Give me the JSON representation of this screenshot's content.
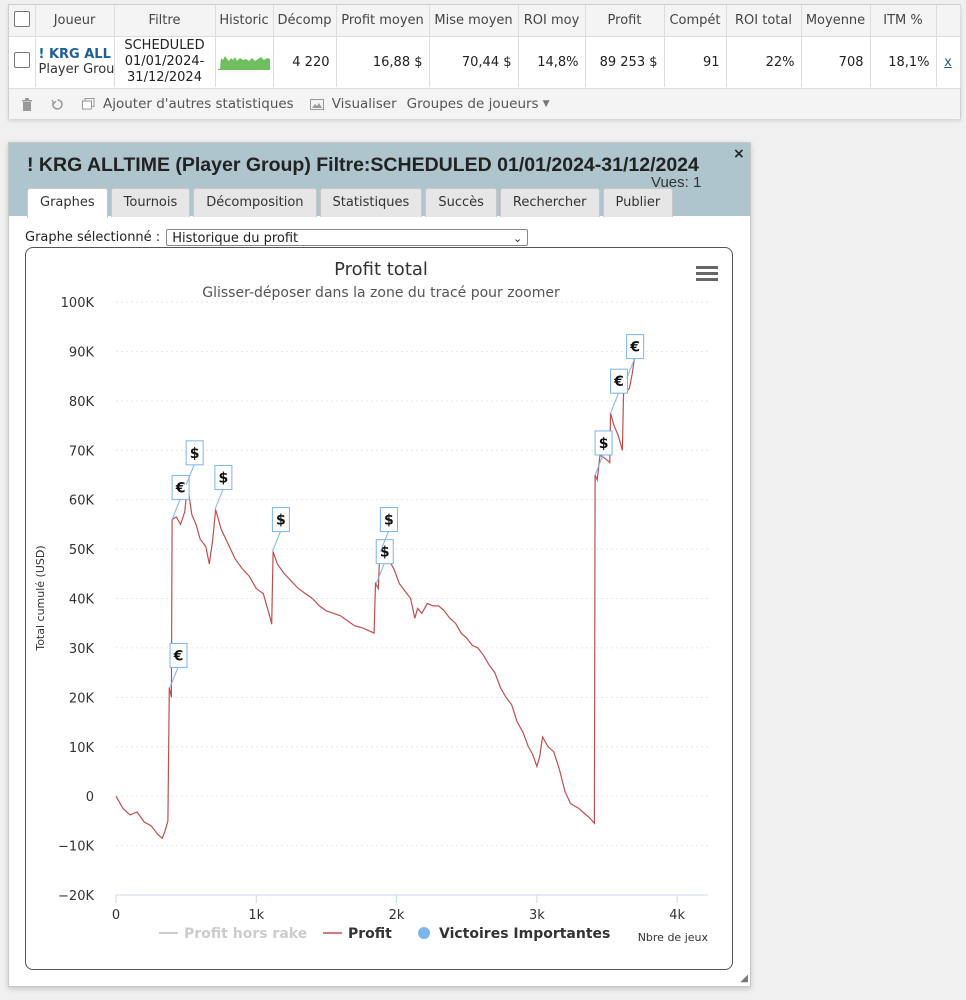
{
  "table": {
    "headers": [
      "Joueur",
      "Filtre",
      "Historic",
      "Décomp",
      "Profit moyen",
      "Mise moyen",
      "ROI moy",
      "Profit",
      "Compét",
      "ROI total",
      "Moyenne",
      "ITM %"
    ],
    "row": {
      "player_name": "! KRG ALL",
      "player_sub": "Player Grou",
      "filter": "SCHEDULED 01/01/2024-31/12/2024",
      "decomp": "4 220",
      "profit_moyen": "16,88 $",
      "mise_moyen": "70,44 $",
      "roi_moy": "14,8%",
      "profit": "89 253 $",
      "compet": "91",
      "roi_total": "22%",
      "moyenne": "708",
      "itm": "18,1%",
      "remove": "x"
    }
  },
  "toolbar": {
    "add_stats": "Ajouter d'autres statistiques",
    "visualize": "Visualiser",
    "groups": "Groupes de joueurs"
  },
  "dialog": {
    "title": "! KRG ALLTIME (Player Group) Filtre:SCHEDULED 01/01/2024-31/12/2024",
    "views": "Vues: 1",
    "close": "×",
    "tabs": [
      "Graphes",
      "Tournois",
      "Décomposition",
      "Statistiques",
      "Succès",
      "Rechercher",
      "Publier"
    ],
    "active_tab": 0,
    "select_label": "Graphe sélectionné :",
    "select_value": "Historique du profit"
  },
  "chart_data": {
    "type": "line",
    "title": "Profit total",
    "subtitle": "Glisser-déposer dans la zone du tracé pour zoomer",
    "xlabel": "Nbre de jeux",
    "ylabel": "Total cumulé (USD)",
    "xlim": [
      0,
      4220
    ],
    "ylim": [
      -20000,
      100000
    ],
    "x_ticks": [
      0,
      1000,
      2000,
      3000,
      4000
    ],
    "x_tick_labels": [
      "0",
      "1k",
      "2k",
      "3k",
      "4k"
    ],
    "y_ticks": [
      -20000,
      -10000,
      0,
      10000,
      20000,
      30000,
      40000,
      50000,
      60000,
      70000,
      80000,
      90000,
      100000
    ],
    "y_tick_labels": [
      "−20K",
      "−10K",
      "0",
      "10K",
      "20K",
      "30K",
      "40K",
      "50K",
      "60K",
      "70K",
      "80K",
      "90K",
      "100K"
    ],
    "grid": true,
    "legend": [
      "Profit hors rake",
      "Profit",
      "Victoires Importantes"
    ],
    "series": [
      {
        "name": "Profit",
        "color": "#c0504d",
        "points": [
          [
            0,
            0
          ],
          [
            50,
            -2500
          ],
          [
            100,
            -3800
          ],
          [
            150,
            -3200
          ],
          [
            200,
            -5200
          ],
          [
            250,
            -6000
          ],
          [
            300,
            -7800
          ],
          [
            330,
            -8500
          ],
          [
            350,
            -7000
          ],
          [
            370,
            -5000
          ],
          [
            380,
            22000
          ],
          [
            395,
            20000
          ],
          [
            400,
            56000
          ],
          [
            430,
            56500
          ],
          [
            460,
            55000
          ],
          [
            490,
            57500
          ],
          [
            510,
            63000
          ],
          [
            540,
            57000
          ],
          [
            570,
            55000
          ],
          [
            600,
            52000
          ],
          [
            640,
            50500
          ],
          [
            665,
            47000
          ],
          [
            690,
            52000
          ],
          [
            710,
            58000
          ],
          [
            750,
            54000
          ],
          [
            800,
            51000
          ],
          [
            850,
            48000
          ],
          [
            900,
            46000
          ],
          [
            950,
            44500
          ],
          [
            1000,
            42000
          ],
          [
            1050,
            41000
          ],
          [
            1080,
            38000
          ],
          [
            1100,
            36000
          ],
          [
            1110,
            34800
          ],
          [
            1120,
            49500
          ],
          [
            1150,
            47000
          ],
          [
            1200,
            45000
          ],
          [
            1250,
            43500
          ],
          [
            1300,
            42000
          ],
          [
            1350,
            41000
          ],
          [
            1400,
            40000
          ],
          [
            1450,
            38500
          ],
          [
            1500,
            37500
          ],
          [
            1550,
            37000
          ],
          [
            1600,
            36500
          ],
          [
            1650,
            35500
          ],
          [
            1700,
            34500
          ],
          [
            1760,
            34000
          ],
          [
            1800,
            33500
          ],
          [
            1840,
            33000
          ],
          [
            1850,
            43000
          ],
          [
            1870,
            42000
          ],
          [
            1880,
            49000
          ],
          [
            1900,
            49500
          ],
          [
            1940,
            48000
          ],
          [
            1980,
            46000
          ],
          [
            2020,
            43000
          ],
          [
            2060,
            41500
          ],
          [
            2100,
            40000
          ],
          [
            2130,
            36000
          ],
          [
            2150,
            38000
          ],
          [
            2180,
            37000
          ],
          [
            2220,
            39000
          ],
          [
            2260,
            38500
          ],
          [
            2300,
            38500
          ],
          [
            2340,
            37500
          ],
          [
            2380,
            36000
          ],
          [
            2420,
            35000
          ],
          [
            2460,
            33000
          ],
          [
            2500,
            32000
          ],
          [
            2540,
            30500
          ],
          [
            2580,
            30000
          ],
          [
            2620,
            28500
          ],
          [
            2660,
            26500
          ],
          [
            2700,
            25000
          ],
          [
            2740,
            22000
          ],
          [
            2780,
            20000
          ],
          [
            2820,
            18500
          ],
          [
            2860,
            15000
          ],
          [
            2900,
            13000
          ],
          [
            2940,
            10000
          ],
          [
            2970,
            8500
          ],
          [
            3000,
            6000
          ],
          [
            3020,
            8000
          ],
          [
            3040,
            12000
          ],
          [
            3080,
            10000
          ],
          [
            3120,
            9000
          ],
          [
            3160,
            5500
          ],
          [
            3200,
            1000
          ],
          [
            3240,
            -1500
          ],
          [
            3300,
            -2500
          ],
          [
            3340,
            -3500
          ],
          [
            3380,
            -4500
          ],
          [
            3410,
            -5500
          ],
          [
            3415,
            65000
          ],
          [
            3430,
            64000
          ],
          [
            3450,
            69000
          ],
          [
            3480,
            68500
          ],
          [
            3500,
            68000
          ],
          [
            3520,
            67500
          ],
          [
            3525,
            77500
          ],
          [
            3550,
            75000
          ],
          [
            3580,
            73000
          ],
          [
            3610,
            70000
          ],
          [
            3620,
            84000
          ],
          [
            3640,
            82000
          ],
          [
            3660,
            82500
          ],
          [
            3680,
            85500
          ],
          [
            3700,
            89500
          ],
          [
            3720,
            90500
          ],
          [
            3740,
            91000
          ],
          [
            3750,
            89500
          ]
        ]
      }
    ],
    "markers": [
      {
        "x": 385,
        "y": 22000,
        "label": "€"
      },
      {
        "x": 400,
        "y": 56000,
        "label": "€"
      },
      {
        "x": 500,
        "y": 63000,
        "label": "$"
      },
      {
        "x": 705,
        "y": 58000,
        "label": "$"
      },
      {
        "x": 1115,
        "y": 49500,
        "label": "$"
      },
      {
        "x": 1855,
        "y": 43000,
        "label": "$"
      },
      {
        "x": 1885,
        "y": 49500,
        "label": "$"
      },
      {
        "x": 3415,
        "y": 65000,
        "label": "$"
      },
      {
        "x": 3525,
        "y": 77500,
        "label": "€"
      },
      {
        "x": 3640,
        "y": 84500,
        "label": "€"
      }
    ]
  }
}
